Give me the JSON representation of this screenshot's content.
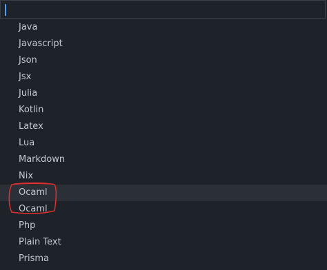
{
  "search": {
    "value": "",
    "placeholder": ""
  },
  "languages": [
    {
      "label": "Java"
    },
    {
      "label": "Javascript"
    },
    {
      "label": "Json"
    },
    {
      "label": "Jsx"
    },
    {
      "label": "Julia"
    },
    {
      "label": "Kotlin"
    },
    {
      "label": "Latex"
    },
    {
      "label": "Lua"
    },
    {
      "label": "Markdown"
    },
    {
      "label": "Nix"
    },
    {
      "label": "Ocaml",
      "selected": true
    },
    {
      "label": "Ocaml"
    },
    {
      "label": "Php"
    },
    {
      "label": "Plain Text"
    },
    {
      "label": "Prisma"
    }
  ],
  "colors": {
    "background": "#1e2229",
    "text": "#c5c9d1",
    "selected_row": "#2b2f36",
    "caret": "#4aa0ff",
    "annotation": "#e03030"
  }
}
